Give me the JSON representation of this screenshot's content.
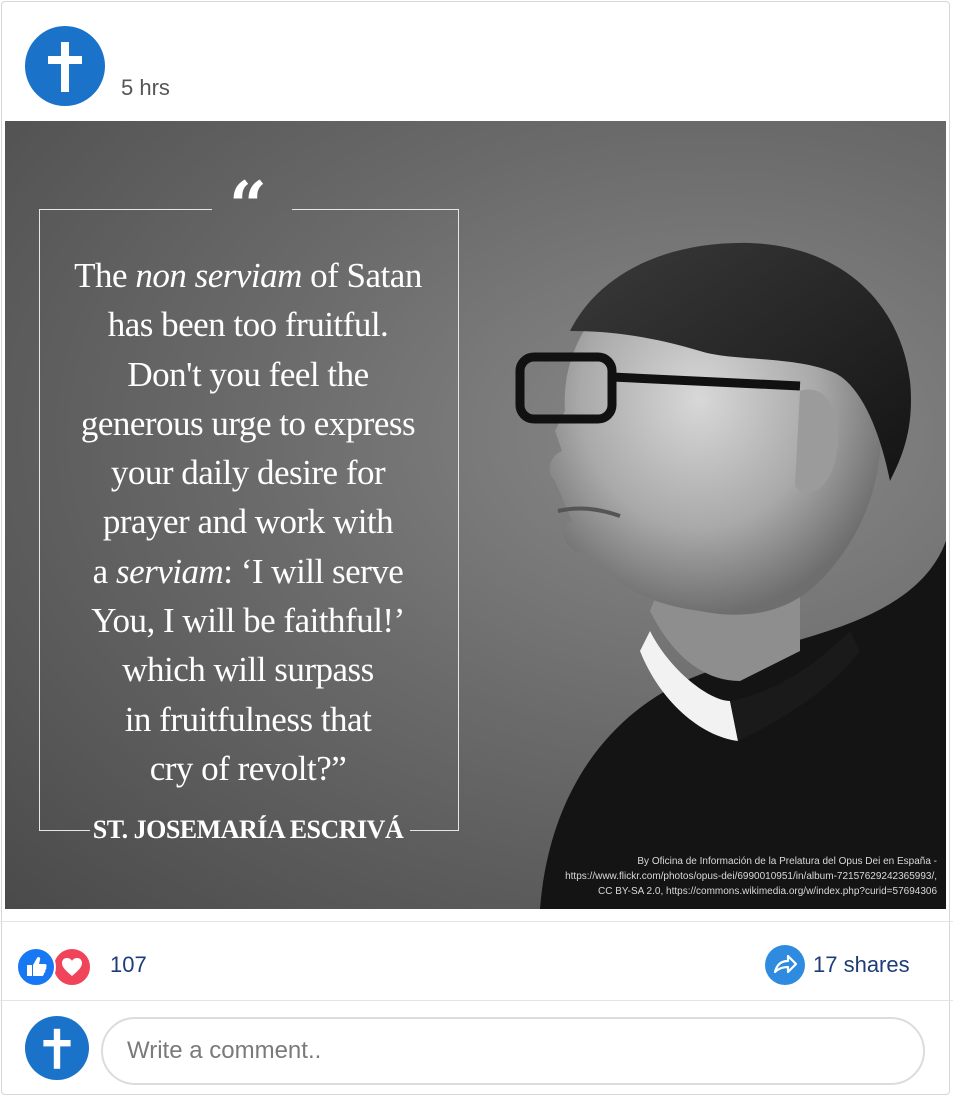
{
  "post": {
    "avatar_icon": "cross-icon",
    "time": "5 hrs",
    "accent_color": "#1a73c9"
  },
  "image": {
    "quote_mark": "“",
    "quote_lines": [
      {
        "parts": [
          {
            "t": "The "
          },
          {
            "t": "non serviam",
            "i": true
          },
          {
            "t": " of Satan"
          }
        ]
      },
      {
        "parts": [
          {
            "t": "has been too fruitful."
          }
        ]
      },
      {
        "parts": [
          {
            "t": "Don't you feel the"
          }
        ]
      },
      {
        "parts": [
          {
            "t": "generous urge to express"
          }
        ]
      },
      {
        "parts": [
          {
            "t": "your daily desire for"
          }
        ]
      },
      {
        "parts": [
          {
            "t": "prayer and work with"
          }
        ]
      },
      {
        "parts": [
          {
            "t": "a "
          },
          {
            "t": "serviam",
            "i": true
          },
          {
            "t": ": ‘I will serve"
          }
        ]
      },
      {
        "parts": [
          {
            "t": "You, I will be faithful!’"
          }
        ]
      },
      {
        "parts": [
          {
            "t": "which will surpass"
          }
        ]
      },
      {
        "parts": [
          {
            "t": "in fruitfulness that"
          }
        ]
      },
      {
        "parts": [
          {
            "t": "cry of revolt?”"
          }
        ]
      }
    ],
    "author": "ST. JOSEMARÍA ESCRIVÁ",
    "credit_lines": [
      "By Oficina de Información de la Prelatura del Opus Dei en España -",
      "https://www.flickr.com/photos/opus-dei/6990010951/in/album-72157629242365993/,",
      "CC BY-SA 2.0, https://commons.wikimedia.org/w/index.php?curid=57694306"
    ]
  },
  "reactions": {
    "icons": [
      "like-icon",
      "love-icon"
    ],
    "count": "107",
    "shares": "17 shares",
    "like_color": "#1877f2",
    "love_color": "#f0445a"
  },
  "comment": {
    "placeholder": "Write a comment.."
  }
}
